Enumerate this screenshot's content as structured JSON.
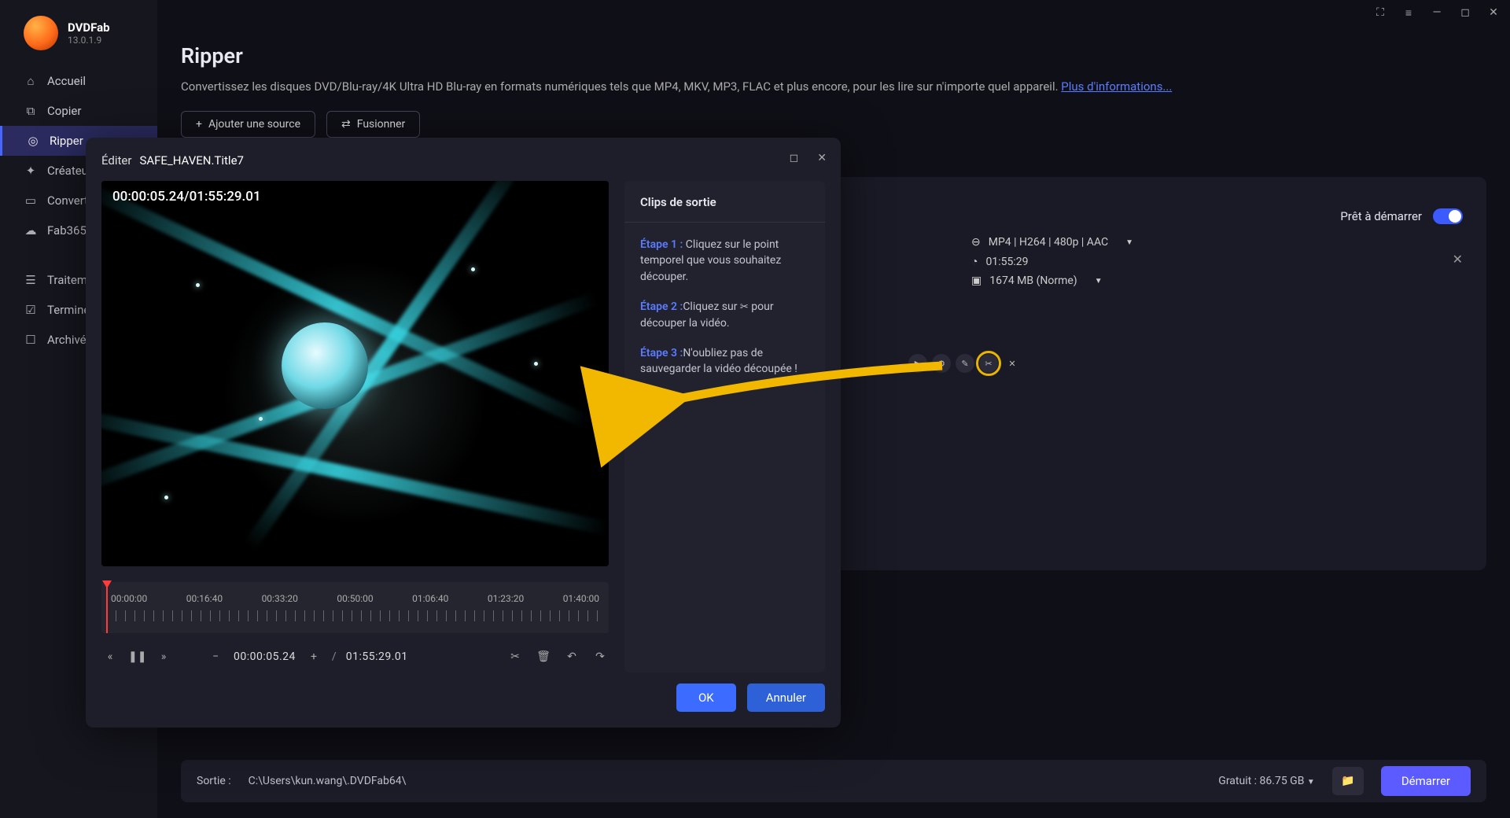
{
  "app": {
    "name": "DVDFab",
    "version": "13.0.1.9"
  },
  "topbar_icons": [
    "gift",
    "menu",
    "minimize",
    "maximize",
    "close"
  ],
  "sidebar": {
    "items": [
      {
        "icon": "home",
        "label": "Accueil"
      },
      {
        "icon": "copy",
        "label": "Copier"
      },
      {
        "icon": "ripper",
        "label": "Ripper",
        "active": true
      },
      {
        "icon": "creator",
        "label": "Créateur"
      },
      {
        "icon": "convert",
        "label": "Convertisseur"
      },
      {
        "icon": "fab365",
        "label": "Fab365"
      }
    ],
    "lower": [
      {
        "icon": "queue",
        "label": "Traitement"
      },
      {
        "icon": "done",
        "label": "Terminé"
      },
      {
        "icon": "archive",
        "label": "Archivé"
      }
    ]
  },
  "header": {
    "title": "Ripper",
    "desc": "Convertissez les disques DVD/Blu-ray/4K Ultra HD Blu-ray en formats numériques tels que MP4, MKV, MP3, FLAC et plus encore, pour les lire sur n'importe quel appareil. ",
    "more": "Plus d'informations...",
    "add_source": "Ajouter une source",
    "merge": "Fusionner"
  },
  "card": {
    "ready": "Prêt à démarrer",
    "format": "MP4 | H264 | 480p | AAC",
    "duration": "01:55:29",
    "size": "1674 MB (Norme)"
  },
  "bottom": {
    "out_label": "Sortie :",
    "out_path": "C:\\Users\\kun.wang\\.DVDFab64\\",
    "free": "Gratuit : 86.75 GB",
    "start": "Démarrer"
  },
  "dialog": {
    "edit": "Éditer",
    "filename": "SAFE_HAVEN.Title7",
    "timecode": "00:00:05.24/01:55:29.01",
    "clips_title": "Clips de sortie",
    "steps": [
      {
        "label": "Étape 1 :",
        "text": "Cliquez sur le point temporel que vous souhaitez découper."
      },
      {
        "label": "Étape 2 :",
        "text_pre": "Cliquez sur ",
        "icon": "✂",
        "text_post": " pour découper la vidéo."
      },
      {
        "label": "Étape 3 :",
        "text": "N'oubliez pas de sauvegarder la vidéo découpée !"
      }
    ],
    "timeline_labels": [
      "00:00:00",
      "00:16:40",
      "00:33:20",
      "00:50:00",
      "01:06:40",
      "01:23:20",
      "01:40:00"
    ],
    "current_tc": "00:00:05.24",
    "total_tc": "01:55:29.01",
    "ok": "OK",
    "cancel": "Annuler"
  }
}
